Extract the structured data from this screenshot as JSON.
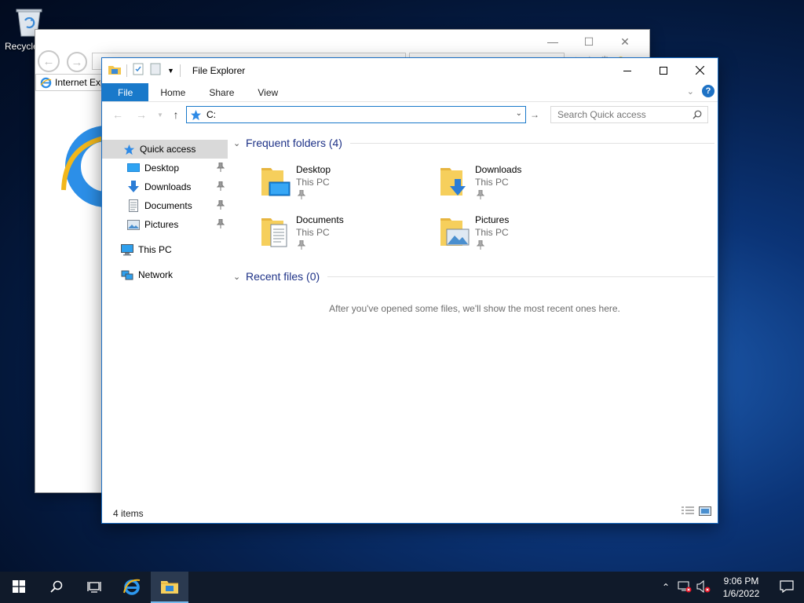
{
  "desktop": {
    "recycle_bin_label": "Recycle Bin"
  },
  "ie_window": {
    "tab_label": "Internet Explorer"
  },
  "explorer": {
    "title": "File Explorer",
    "ribbon_tabs": [
      "File",
      "Home",
      "Share",
      "View"
    ],
    "address_value": "C:",
    "search_placeholder": "Search Quick access",
    "nav_pane": {
      "quick_access": "Quick access",
      "pinned": [
        "Desktop",
        "Downloads",
        "Documents",
        "Pictures"
      ],
      "this_pc": "This PC",
      "network": "Network"
    },
    "frequent_header": "Frequent folders (4)",
    "folders": [
      {
        "name": "Desktop",
        "location": "This PC"
      },
      {
        "name": "Downloads",
        "location": "This PC"
      },
      {
        "name": "Documents",
        "location": "This PC"
      },
      {
        "name": "Pictures",
        "location": "This PC"
      }
    ],
    "recent_header": "Recent files (0)",
    "recent_empty_message": "After you've opened some files, we'll show the most recent ones here.",
    "status_items": "4 items"
  },
  "taskbar": {
    "time": "9:06 PM",
    "date": "1/6/2022"
  },
  "colors": {
    "accent": "#1979ca",
    "group_header": "#1e3287",
    "taskbar": "#101a2a"
  }
}
